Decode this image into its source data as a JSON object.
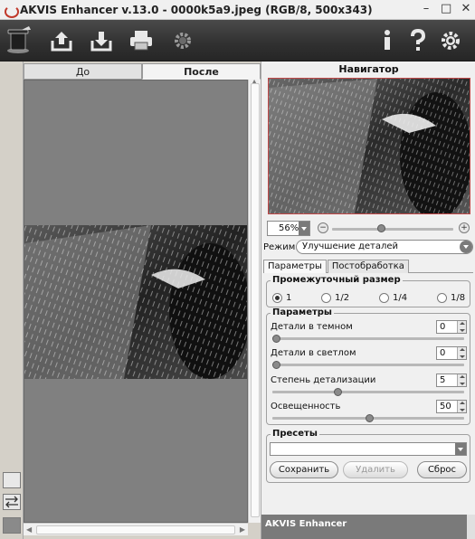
{
  "window": {
    "title": "AKVIS Enhancer v.13.0 - 0000k5a9.jpeg (RGB/8, 500x343)",
    "minimize": "–",
    "maximize": "□",
    "close": "✕"
  },
  "toolbar": {
    "left_icons": [
      "run-icon",
      "export-icon",
      "import-icon",
      "print-icon",
      "settings-gear-icon"
    ],
    "right_icons": [
      "info-icon",
      "help-icon",
      "preferences-gear-icon"
    ]
  },
  "view_tabs": {
    "before": "До",
    "after": "После",
    "active": "after"
  },
  "navigator": {
    "title": "Навигатор",
    "zoom": "56%",
    "zoom_out": "−",
    "zoom_in": "+",
    "zoom_slider_fraction": 0.4
  },
  "mode": {
    "label": "Режим:",
    "value": "Улучшение деталей"
  },
  "param_tabs": {
    "params": "Параметры",
    "postprocess": "Постобработка",
    "active": "params"
  },
  "intermediate_size": {
    "title": "Промежуточный размер",
    "options": [
      "1",
      "1/2",
      "1/4",
      "1/8"
    ],
    "selected": "1"
  },
  "parameters": {
    "title": "Параметры",
    "items": [
      {
        "label": "Детали в темном",
        "value": "0",
        "slider_fraction": 0.0
      },
      {
        "label": "Детали в светлом",
        "value": "0",
        "slider_fraction": 0.0
      },
      {
        "label": "Степень детализации",
        "value": "5",
        "slider_fraction": 0.33
      },
      {
        "label": "Освещенность",
        "value": "50",
        "slider_fraction": 0.5
      }
    ]
  },
  "presets": {
    "title": "Пресеты",
    "selected": "",
    "save": "Сохранить",
    "delete": "Удалить",
    "reset": "Сброс"
  },
  "footer": {
    "label": "AKVIS Enhancer"
  }
}
